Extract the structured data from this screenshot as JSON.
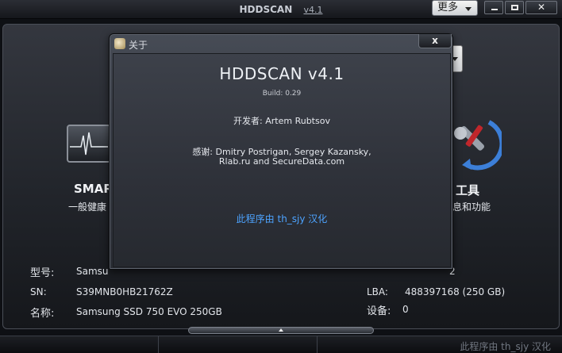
{
  "window": {
    "title": "HDDSCAN",
    "version_link": "v4.1",
    "more_menu_label": "更多",
    "minimize_label": "minimize",
    "maximize_label": "maximize",
    "close_label": "close"
  },
  "features": {
    "smart": {
      "label": "SMAR",
      "sub": "一般健康"
    },
    "tools": {
      "label": "工具",
      "sub": "息和功能"
    }
  },
  "drive_info": {
    "model_label": "型号:",
    "model_value": "Samsu",
    "model_tail": "2",
    "sn_label": "SN:",
    "sn_value": "S39MNB0HB21762Z",
    "name_label": "名称:",
    "name_value": "Samsung SSD 750 EVO 250GB",
    "lba_label": "LBA:",
    "lba_value": "488397168 (250 GB)",
    "device_label": "设备:",
    "device_value": "0"
  },
  "statusbar": {
    "credit": "此程序由 th_sjy 汉化"
  },
  "about_dialog": {
    "title": "关于",
    "close_glyph": "x",
    "app_name": "HDDSCAN v4.1",
    "build": "Build: 0.29",
    "developer": "开发者: Artem Rubtsov",
    "thanks_line1": "感谢: Dmitry Postrigan, Sergey Kazansky,",
    "thanks_line2": "Rlab.ru and SecureData.com",
    "localization_credit": "此程序由 th_sjy 汉化"
  },
  "colors": {
    "link": "#4da3ff",
    "background": "#22252b",
    "dialog": "#383c45"
  },
  "icons": [
    "smart-heartbeat-icon",
    "tools-wrench-icon",
    "about-app-icon",
    "close-icon",
    "minimize-icon",
    "maximize-icon",
    "chevron-down-icon",
    "chevron-up-icon"
  ]
}
